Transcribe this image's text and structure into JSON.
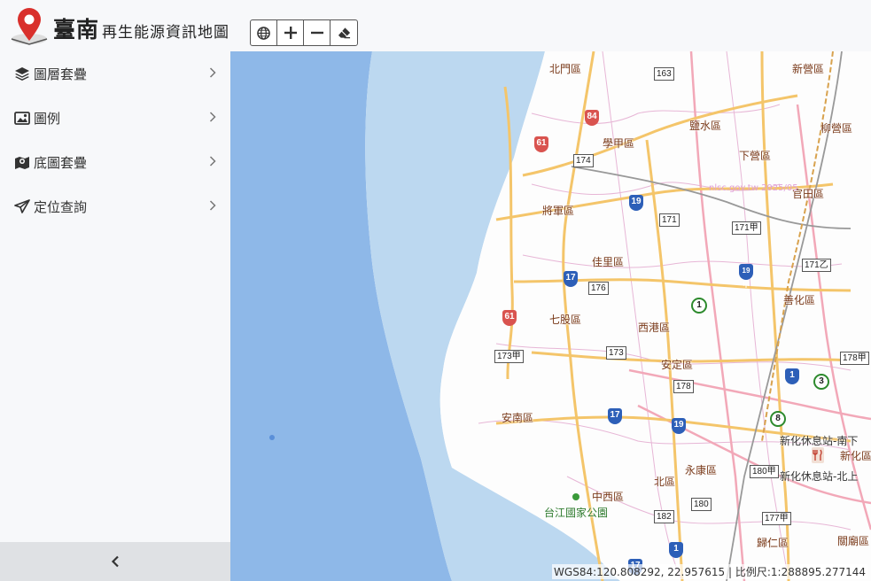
{
  "header": {
    "brand_main": "臺南",
    "brand_sub": "再生能源資訊地圖",
    "tools": [
      {
        "name": "globe-icon"
      },
      {
        "name": "zoom-in-icon"
      },
      {
        "name": "zoom-out-icon"
      },
      {
        "name": "eraser-icon"
      }
    ]
  },
  "sidebar": {
    "items": [
      {
        "label": "圖層套疊",
        "icon": "layers-icon"
      },
      {
        "label": "圖例",
        "icon": "image-icon"
      },
      {
        "label": "底圖套疊",
        "icon": "map-marker-icon"
      },
      {
        "label": "定位查詢",
        "icon": "paper-plane-icon"
      }
    ],
    "collapse_icon": "chevron-left-icon"
  },
  "map": {
    "districts": [
      "北門區",
      "新營區",
      "學甲區",
      "鹽水區",
      "柳營區",
      "下營區",
      "將軍區",
      "官田區",
      "佳里區",
      "善化區",
      "七股區",
      "西港區",
      "安定區",
      "安南區",
      "北區",
      "永康區",
      "中西區",
      "新化區",
      "歸仁區",
      "關廟區"
    ],
    "places": [
      "台江國家公園",
      "新化休息站-南下",
      "新化休息站-北上"
    ],
    "routes": [
      "163",
      "84",
      "61",
      "174",
      "19",
      "171",
      "171甲",
      "19甲",
      "171乙",
      "17",
      "176",
      "1",
      "173甲",
      "173",
      "178甲",
      "178",
      "3",
      "8",
      "180甲",
      "182",
      "180",
      "177甲"
    ],
    "watermark": "nlsc.gov.tw 2025/05",
    "coords_text": "WGS84:120.808292, 22.957615 | 比例尺:1:288895.277144"
  },
  "colors": {
    "sea_deep": "#8eb8e8",
    "sea_shallow": "#bcd8f0",
    "road_major": "#f4c56a",
    "road_pink": "#f2a8b8",
    "land": "#fdfdfd"
  }
}
